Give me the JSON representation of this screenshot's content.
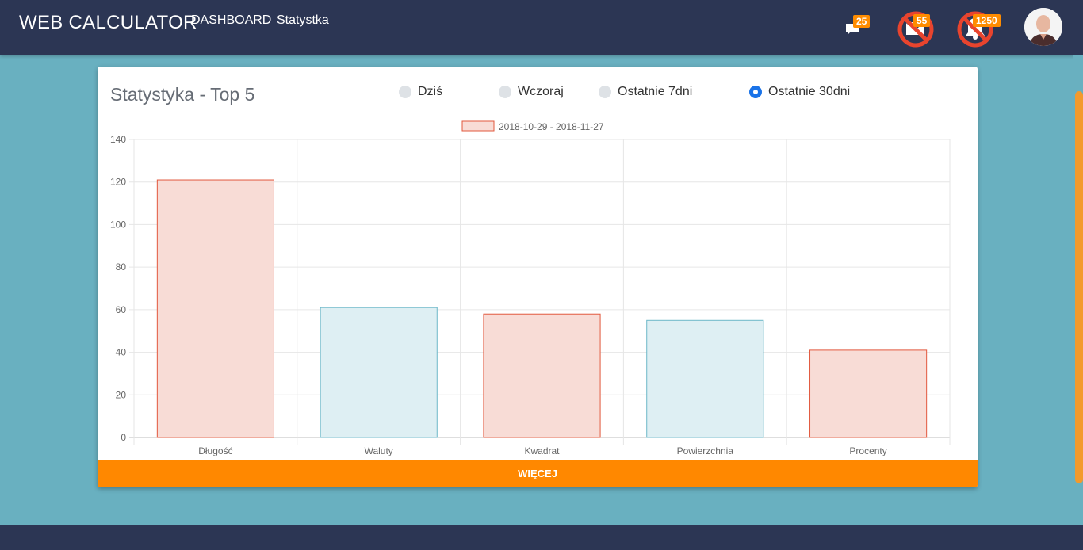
{
  "header": {
    "brand": "WEB CALCULATOR",
    "nav": [
      {
        "label": "DASHBOARD"
      },
      {
        "label": "Statystka"
      }
    ],
    "icons": {
      "messages_badge": "25",
      "mail_badge": "55",
      "notifications_badge": "1250"
    }
  },
  "card": {
    "title": "Statystyka - Top 5",
    "radios": [
      {
        "label": "Dziś",
        "checked": false
      },
      {
        "label": "Wczoraj",
        "checked": false
      },
      {
        "label": "Ostatnie 7dni",
        "checked": false
      },
      {
        "label": "Ostatnie 30dni",
        "checked": true
      }
    ],
    "more_button": "WIĘCEJ"
  },
  "colors": {
    "nav_bg": "#2c3654",
    "page_bg": "#69b0c0",
    "accent": "#ff8800",
    "bar_red_fill": "#f8dcd6",
    "bar_red_stroke": "#e2583e",
    "bar_blue_fill": "#deeff3",
    "bar_blue_stroke": "#6bb7c8"
  },
  "chart_data": {
    "type": "bar",
    "categories": [
      "Długość",
      "Waluty",
      "Kwadrat",
      "Powierzchnia",
      "Procenty"
    ],
    "series": [
      {
        "name": "2018-10-29 - 2018-11-27",
        "values": [
          121,
          61,
          58,
          55,
          41
        ]
      }
    ],
    "ylim": [
      0,
      140
    ],
    "yticks": [
      "0",
      "20",
      "40",
      "60",
      "80",
      "100",
      "120",
      "140"
    ],
    "grid": true,
    "legend": "top-center",
    "bar_colors": [
      "red",
      "blue",
      "red",
      "blue",
      "red"
    ]
  }
}
